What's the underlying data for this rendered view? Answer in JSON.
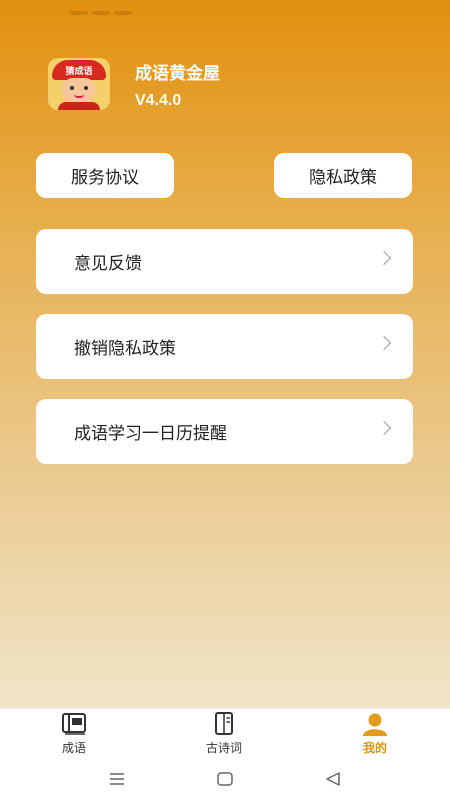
{
  "app": {
    "name": "成语黄金屋",
    "version": "V4.4.0",
    "icon_label": "猜成语"
  },
  "buttons": {
    "service_agreement": "服务协议",
    "privacy_policy": "隐私政策"
  },
  "menu": [
    {
      "label": "意见反馈",
      "icon": "chevron-right-icon"
    },
    {
      "label": "撤销隐私政策",
      "icon": "chevron-right-icon"
    },
    {
      "label": "成语学习一日历提醒",
      "icon": "chevron-right-icon"
    }
  ],
  "tabs": [
    {
      "label": "成语",
      "icon": "idiom-book-icon",
      "active": false
    },
    {
      "label": "古诗词",
      "icon": "poetry-book-icon",
      "active": false
    },
    {
      "label": "我的",
      "icon": "user-icon",
      "active": true
    }
  ],
  "colors": {
    "gradient_top": "#e2900e",
    "gradient_bottom": "#f0e4c8",
    "active_tab": "#d99411"
  }
}
